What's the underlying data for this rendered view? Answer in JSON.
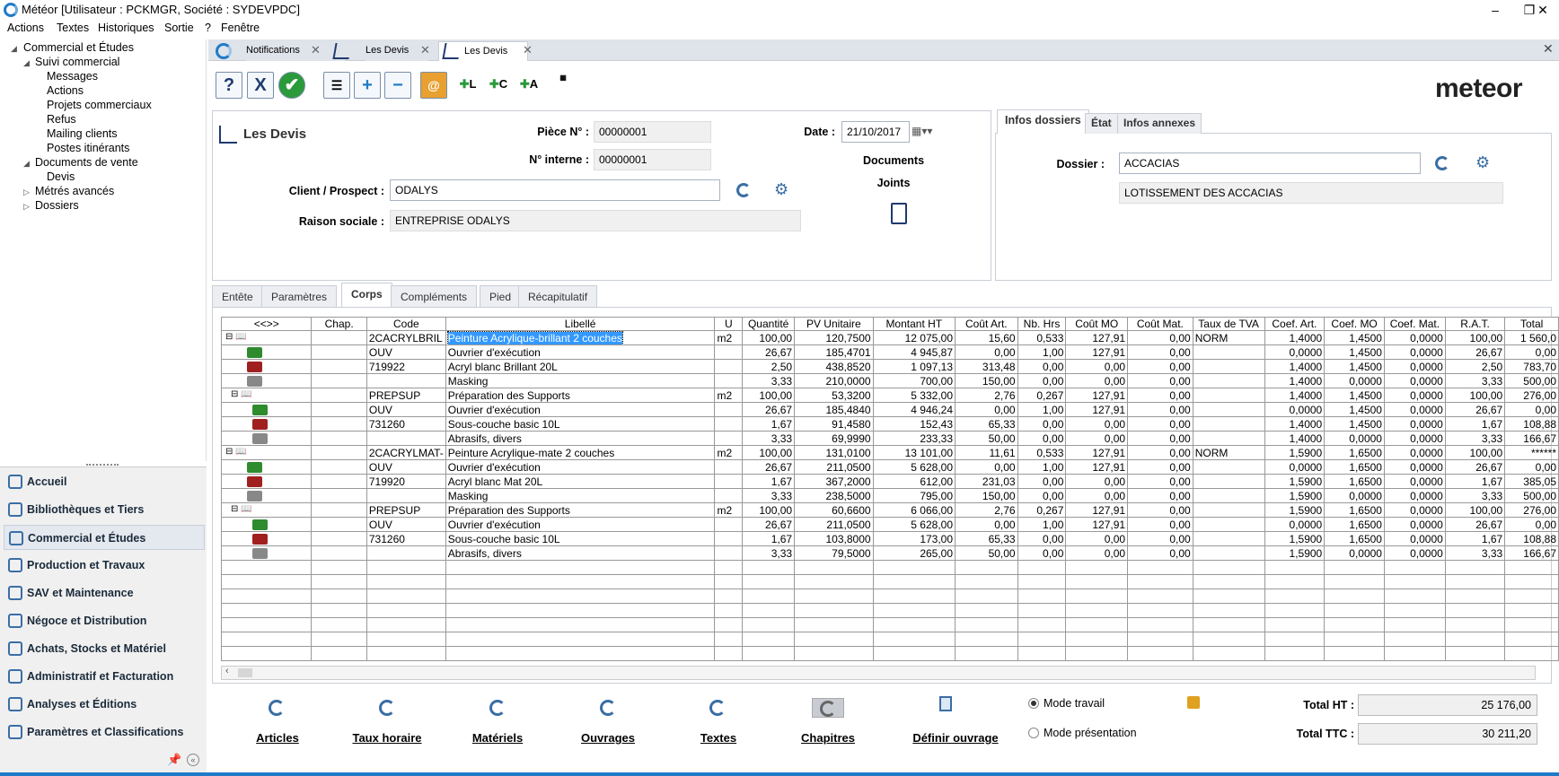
{
  "window": {
    "title": "Météor [Utilisateur : PCKMGR, Société : SYDEVPDC]",
    "min": "–",
    "max": "❐",
    "close": "✕"
  },
  "menu": [
    "Actions",
    "Textes",
    "Historiques",
    "Sortie",
    "?",
    "Fenêtre"
  ],
  "tree": {
    "items": [
      "Commercial et Études",
      "Suivi commercial",
      "Messages",
      "Actions",
      "Projets commerciaux",
      "Refus",
      "Mailing clients",
      "Postes itinérants",
      "Documents de vente",
      "Devis",
      "Métrés avancés",
      "Dossiers"
    ]
  },
  "nav": {
    "items": [
      "Accueil",
      "Bibliothèques et Tiers",
      "Commercial et Études",
      "Production et Travaux",
      "SAV et Maintenance",
      "Négoce et Distribution",
      "Achats, Stocks et Matériel",
      "Administratif et Facturation",
      "Analyses et Éditions",
      "Paramètres et Classifications"
    ]
  },
  "doc_tabs": [
    {
      "label": "Notifications"
    },
    {
      "label": "Les Devis"
    },
    {
      "label": "Les Devis"
    }
  ],
  "toolbar": {
    "help": "?",
    "cancel": "X",
    "ok": "✔",
    "add": "+",
    "remove": "−"
  },
  "logo": "meteor",
  "header": {
    "title": "Les Devis",
    "piece_label": "Pièce N° :",
    "piece_value": "00000001",
    "interne_label": "N° interne :",
    "interne_value": "00000001",
    "date_label": "Date :",
    "date_value": "21/10/2017",
    "client_label": "Client / Prospect :",
    "client_value": "ODALYS",
    "raison_label": "Raison sociale :",
    "raison_value": "ENTREPRISE ODALYS",
    "documents": "Documents",
    "joints": "Joints"
  },
  "infos": {
    "tabs": [
      "Infos dossiers",
      "État",
      "Infos annexes"
    ],
    "dossier_label": "Dossier :",
    "dossier_value": "ACCACIAS",
    "dossier_desc": "LOTISSEMENT DES ACCACIAS"
  },
  "sub_tabs": [
    "Entête",
    "Paramètres",
    "Corps",
    "Compléments",
    "Pied",
    "Récapitulatif"
  ],
  "grid": {
    "columns": [
      "<<>>",
      "Chap.",
      "Code",
      "Libellé",
      "U",
      "Quantité",
      "PV Unitaire",
      "Montant HT",
      "Coût Art.",
      "Nb. Hrs",
      "Coût MO",
      "Coût Mat.",
      "Taux de TVA",
      "Coef. Art.",
      "Coef. MO",
      "Coef. Mat.",
      "R.A.T.",
      "Total"
    ],
    "rows": [
      [
        "",
        "2CACRYLBRIL",
        "Peinture Acrylique-brillant 2 couches",
        "m2",
        "100,00",
        "120,7500",
        "12 075,00",
        "15,60",
        "0,533",
        "127,91",
        "0,00",
        "NORM",
        "1,4000",
        "1,4500",
        "0,0000",
        "100,00",
        "1 560,0"
      ],
      [
        "",
        "OUV",
        "Ouvrier d'exécution",
        "",
        "26,67",
        "185,4701",
        "4 945,87",
        "0,00",
        "1,00",
        "127,91",
        "0,00",
        "",
        "0,0000",
        "1,4500",
        "0,0000",
        "26,67",
        "0,00"
      ],
      [
        "",
        "719922",
        "Acryl blanc Brillant 20L",
        "",
        "2,50",
        "438,8520",
        "1 097,13",
        "313,48",
        "0,00",
        "0,00",
        "0,00",
        "",
        "1,4000",
        "1,4500",
        "0,0000",
        "2,50",
        "783,70"
      ],
      [
        "",
        "",
        "Masking",
        "",
        "3,33",
        "210,0000",
        "700,00",
        "150,00",
        "0,00",
        "0,00",
        "0,00",
        "",
        "1,4000",
        "0,0000",
        "0,0000",
        "3,33",
        "500,00"
      ],
      [
        "",
        "PREPSUP",
        "Préparation des Supports",
        "m2",
        "100,00",
        "53,3200",
        "5 332,00",
        "2,76",
        "0,267",
        "127,91",
        "0,00",
        "",
        "1,4000",
        "1,4500",
        "0,0000",
        "100,00",
        "276,00"
      ],
      [
        "",
        "OUV",
        "Ouvrier d'exécution",
        "",
        "26,67",
        "185,4840",
        "4 946,24",
        "0,00",
        "1,00",
        "127,91",
        "0,00",
        "",
        "0,0000",
        "1,4500",
        "0,0000",
        "26,67",
        "0,00"
      ],
      [
        "",
        "731260",
        "Sous-couche basic 10L",
        "",
        "1,67",
        "91,4580",
        "152,43",
        "65,33",
        "0,00",
        "0,00",
        "0,00",
        "",
        "1,4000",
        "1,4500",
        "0,0000",
        "1,67",
        "108,88"
      ],
      [
        "",
        "",
        "Abrasifs, divers",
        "",
        "3,33",
        "69,9990",
        "233,33",
        "50,00",
        "0,00",
        "0,00",
        "0,00",
        "",
        "1,4000",
        "0,0000",
        "0,0000",
        "3,33",
        "166,67"
      ],
      [
        "",
        "2CACRYLMAT-",
        "Peinture Acrylique-mate 2 couches",
        "m2",
        "100,00",
        "131,0100",
        "13 101,00",
        "11,61",
        "0,533",
        "127,91",
        "0,00",
        "NORM",
        "1,5900",
        "1,6500",
        "0,0000",
        "100,00",
        "******"
      ],
      [
        "",
        "OUV",
        "Ouvrier d'exécution",
        "",
        "26,67",
        "211,0500",
        "5 628,00",
        "0,00",
        "1,00",
        "127,91",
        "0,00",
        "",
        "0,0000",
        "1,6500",
        "0,0000",
        "26,67",
        "0,00"
      ],
      [
        "",
        "719920",
        "Acryl blanc Mat 20L",
        "",
        "1,67",
        "367,2000",
        "612,00",
        "231,03",
        "0,00",
        "0,00",
        "0,00",
        "",
        "1,5900",
        "1,6500",
        "0,0000",
        "1,67",
        "385,05"
      ],
      [
        "",
        "",
        "Masking",
        "",
        "3,33",
        "238,5000",
        "795,00",
        "150,00",
        "0,00",
        "0,00",
        "0,00",
        "",
        "1,5900",
        "0,0000",
        "0,0000",
        "3,33",
        "500,00"
      ],
      [
        "",
        "PREPSUP",
        "Préparation des Supports",
        "m2",
        "100,00",
        "60,6600",
        "6 066,00",
        "2,76",
        "0,267",
        "127,91",
        "0,00",
        "",
        "1,5900",
        "1,6500",
        "0,0000",
        "100,00",
        "276,00"
      ],
      [
        "",
        "OUV",
        "Ouvrier d'exécution",
        "",
        "26,67",
        "211,0500",
        "5 628,00",
        "0,00",
        "1,00",
        "127,91",
        "0,00",
        "",
        "0,0000",
        "1,6500",
        "0,0000",
        "26,67",
        "0,00"
      ],
      [
        "",
        "731260",
        "Sous-couche basic 10L",
        "",
        "1,67",
        "103,8000",
        "173,00",
        "65,33",
        "0,00",
        "0,00",
        "0,00",
        "",
        "1,5900",
        "1,6500",
        "0,0000",
        "1,67",
        "108,88"
      ],
      [
        "",
        "",
        "Abrasifs, divers",
        "",
        "3,33",
        "79,5000",
        "265,00",
        "50,00",
        "0,00",
        "0,00",
        "0,00",
        "",
        "1,5900",
        "0,0000",
        "0,0000",
        "3,33",
        "166,67"
      ]
    ],
    "row_types": [
      "chapter",
      "ouvrier",
      "article",
      "masking",
      "chapter",
      "ouvrier",
      "article",
      "masking",
      "chapter",
      "ouvrier",
      "article",
      "masking",
      "chapter",
      "ouvrier",
      "article",
      "masking"
    ],
    "row_indent": [
      0,
      1,
      1,
      1,
      1,
      2,
      2,
      2,
      0,
      1,
      1,
      1,
      1,
      2,
      2,
      2
    ]
  },
  "bottom": {
    "buttons": [
      "Articles",
      "Taux horaire",
      "Matériels",
      "Ouvrages",
      "Textes",
      "Chapitres",
      "Définir ouvrage"
    ],
    "mode_travail": "Mode travail",
    "mode_presentation": "Mode présentation",
    "total_ht_label": "Total HT :",
    "total_ht": "25 176,00",
    "total_ttc_label": "Total TTC :",
    "total_ttc": "30 211,20"
  },
  "colors": {
    "accent": "#1f7bc8",
    "selection": "#3399ff",
    "ouvrier": "#2e8b2e",
    "article": "#a02020",
    "masking": "#888888"
  }
}
